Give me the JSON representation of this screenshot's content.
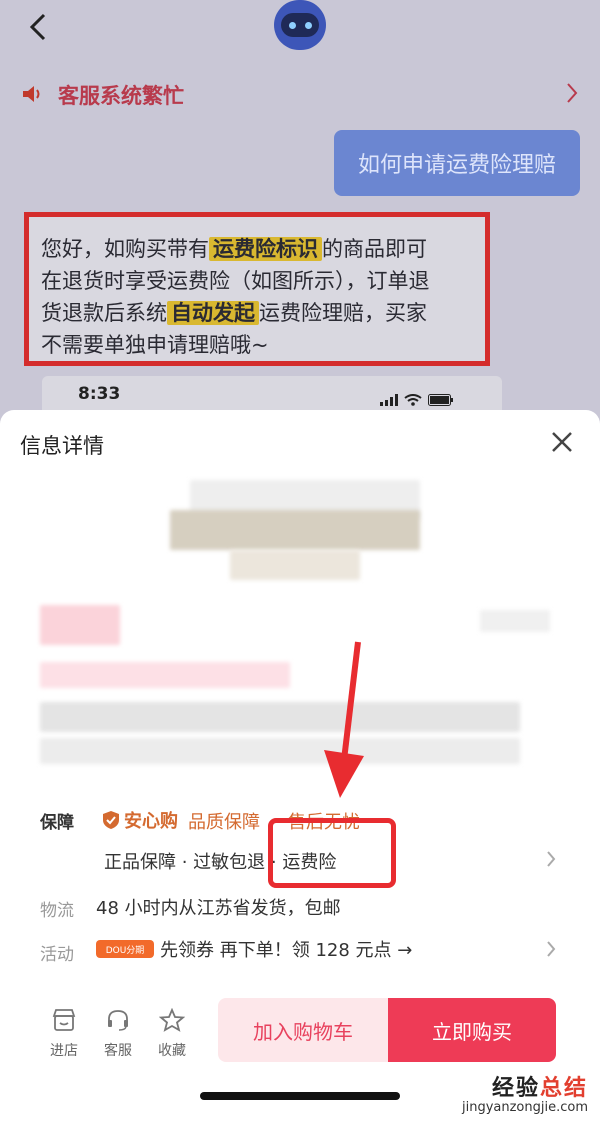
{
  "chat": {
    "notice": "客服系统繁忙",
    "user_message": "如何申请运费险理赔",
    "reply_lines": [
      {
        "pre": "您好，如购买带有",
        "hl": "运费险标识",
        "post": "的商品即可"
      },
      {
        "pre": "在退货时享受运费险（如图所示），订单退",
        "hl": "",
        "post": ""
      },
      {
        "pre": "货退款后系统",
        "hl": "自动发起",
        "post": "运费险理赔，买家"
      },
      {
        "pre": "不需要单独申请理赔哦~",
        "hl": "",
        "post": ""
      }
    ],
    "mini_time": "8:33"
  },
  "sheet": {
    "title": "信息详情",
    "guarantee_label": "保障",
    "anxin_label": "安心购",
    "quality_label": "品质保障",
    "aftersale_label": "售后无忧",
    "guarantee_items": "正品保障 · 过敏包退 · 运费险",
    "logistics_label": "物流",
    "logistics_text": "48 小时内从江苏省发货，包邮",
    "activity_label": "活动",
    "activity_badge": "DOU分期",
    "activity_text": "先领券 再下单！领 128 元点 →"
  },
  "actions": {
    "shop": "进店",
    "service": "客服",
    "favorite": "收藏",
    "add_cart": "加入购物车",
    "buy_now": "立即购买"
  },
  "watermark": {
    "main_a": "经验",
    "main_b": "总结",
    "sub": "jingyanzongjie.com"
  },
  "colors": {
    "accent_red": "#ee3b56",
    "highlight": "#d9b830",
    "annotation_red": "#e82c30",
    "guarantee_orange": "#d46a30"
  }
}
